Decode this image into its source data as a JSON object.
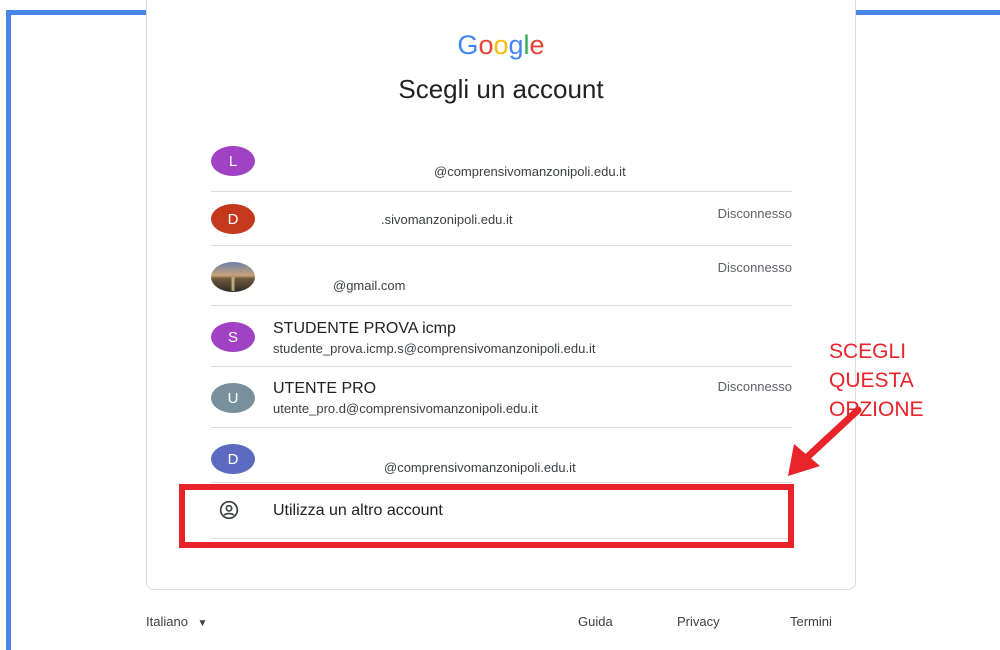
{
  "logo": {
    "letters": [
      {
        "char": "G",
        "color": "#4285F4"
      },
      {
        "char": "o",
        "color": "#EA4335"
      },
      {
        "char": "o",
        "color": "#FBBC05"
      },
      {
        "char": "g",
        "color": "#4285F4"
      },
      {
        "char": "l",
        "color": "#34A853"
      },
      {
        "char": "e",
        "color": "#EA4335"
      }
    ]
  },
  "title": "Scegli un account",
  "accounts": [
    {
      "initial": "L",
      "color": "#a142c4",
      "name": "",
      "email": "@comprensivomanzonipoli.edu.it",
      "status": ""
    },
    {
      "initial": "D",
      "color": "#c4381e",
      "name": "",
      "email": ".sivomanzonipoli.edu.it",
      "status": "Disconnesso"
    },
    {
      "initial": "",
      "color": "photo",
      "name": "",
      "email": "@gmail.com",
      "status": "Disconnesso"
    },
    {
      "initial": "S",
      "color": "#a142c4",
      "name": "STUDENTE PROVA icmp",
      "email": "studente_prova.icmp.s@comprensivomanzonipoli.edu.it",
      "status": ""
    },
    {
      "initial": "U",
      "color": "#78909c",
      "name": "UTENTE PRO",
      "email": "utente_pro.d@comprensivomanzonipoli.edu.it",
      "status": "Disconnesso"
    },
    {
      "initial": "D",
      "color": "#5c6bc0",
      "name": "",
      "email": "@comprensivomanzonipoli.edu.it",
      "status": ""
    }
  ],
  "other_account": {
    "label": "Utilizza un altro account",
    "icon": "person-circle-icon"
  },
  "annotation": {
    "lines": [
      "SCEGLI",
      "QUESTA",
      "OPZIONE"
    ],
    "color": "#e8232a"
  },
  "footer": {
    "language": "Italiano",
    "links": [
      "Guida",
      "Privacy",
      "Termini"
    ]
  }
}
